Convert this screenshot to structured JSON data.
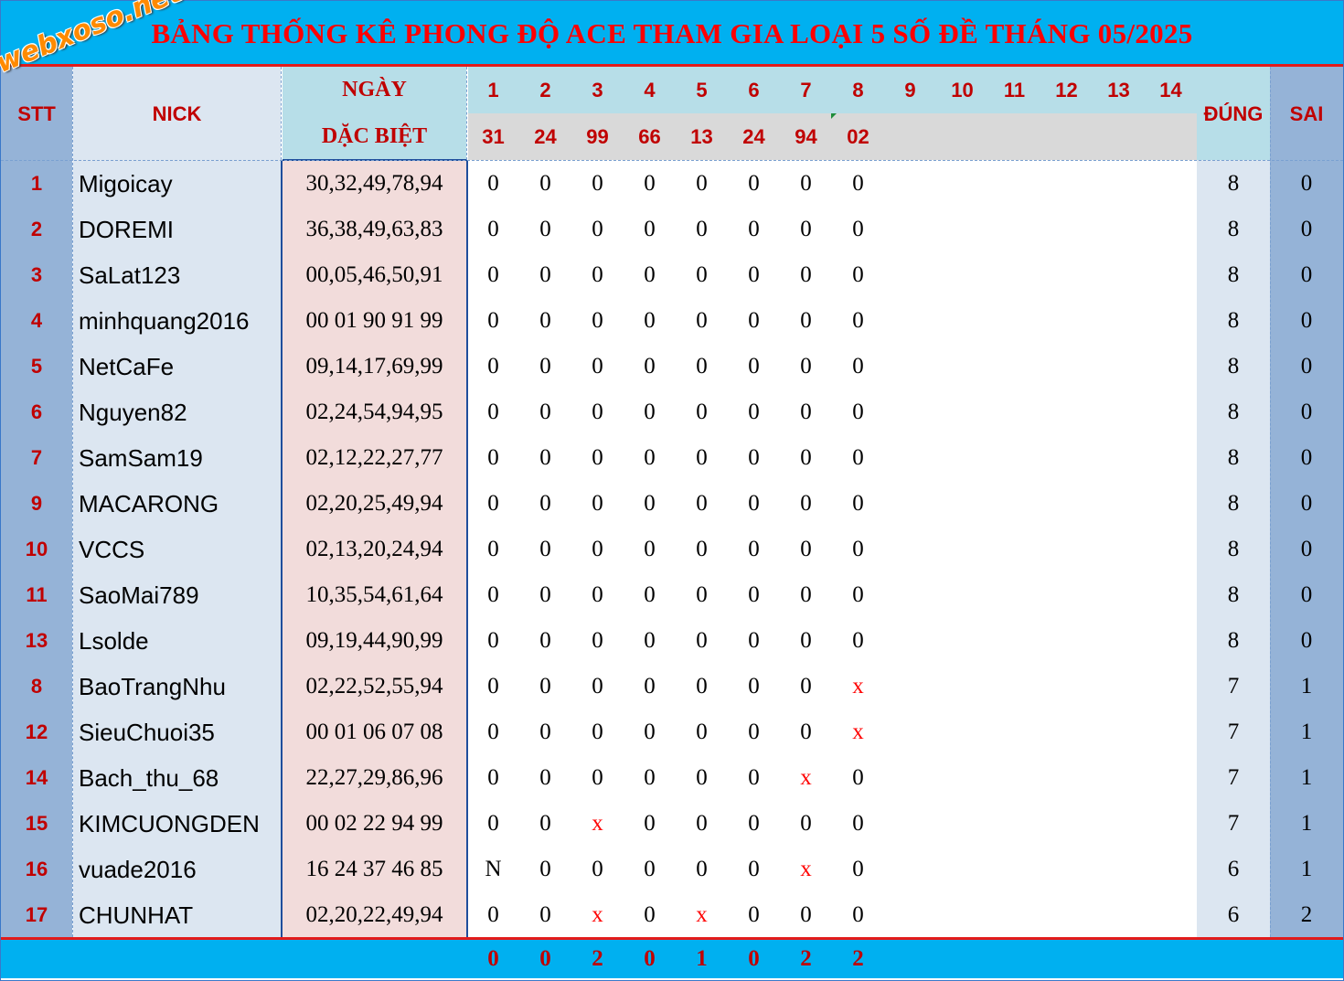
{
  "title": "BẢNG THỐNG KÊ PHONG ĐỘ ACE THAM GIA LOẠI 5 SỐ ĐỀ THÁNG 05/2025",
  "logo": "webxoso.net",
  "headers": {
    "stt": "STT",
    "nick": "NICK",
    "ngay": "NGÀY",
    "dac_biet": "DẶC BIỆT",
    "dung": "ĐÚNG",
    "sai": "SAI"
  },
  "days": [
    "1",
    "2",
    "3",
    "4",
    "5",
    "6",
    "7",
    "8",
    "9",
    "10",
    "11",
    "12",
    "13",
    "14"
  ],
  "specials": [
    "31",
    "24",
    "99",
    "66",
    "13",
    "24",
    "94",
    "02"
  ],
  "rows": [
    {
      "stt": "1",
      "nick": "Migoicay",
      "numbers": "30,32,49,78,94",
      "marks": [
        "0",
        "0",
        "0",
        "0",
        "0",
        "0",
        "0",
        "0"
      ],
      "dung": "8",
      "sai": "0"
    },
    {
      "stt": "2",
      "nick": "DOREMI",
      "numbers": "36,38,49,63,83",
      "marks": [
        "0",
        "0",
        "0",
        "0",
        "0",
        "0",
        "0",
        "0"
      ],
      "dung": "8",
      "sai": "0"
    },
    {
      "stt": "3",
      "nick": "SaLat123",
      "numbers": "00,05,46,50,91",
      "marks": [
        "0",
        "0",
        "0",
        "0",
        "0",
        "0",
        "0",
        "0"
      ],
      "dung": "8",
      "sai": "0"
    },
    {
      "stt": "4",
      "nick": "minhquang2016",
      "numbers": "00 01 90 91 99",
      "marks": [
        "0",
        "0",
        "0",
        "0",
        "0",
        "0",
        "0",
        "0"
      ],
      "dung": "8",
      "sai": "0"
    },
    {
      "stt": "5",
      "nick": "NetCaFe",
      "numbers": "09,14,17,69,99",
      "marks": [
        "0",
        "0",
        "0",
        "0",
        "0",
        "0",
        "0",
        "0"
      ],
      "dung": "8",
      "sai": "0"
    },
    {
      "stt": "6",
      "nick": "Nguyen82",
      "numbers": "02,24,54,94,95",
      "marks": [
        "0",
        "0",
        "0",
        "0",
        "0",
        "0",
        "0",
        "0"
      ],
      "dung": "8",
      "sai": "0"
    },
    {
      "stt": "7",
      "nick": "SamSam19",
      "numbers": "02,12,22,27,77",
      "marks": [
        "0",
        "0",
        "0",
        "0",
        "0",
        "0",
        "0",
        "0"
      ],
      "dung": "8",
      "sai": "0"
    },
    {
      "stt": "9",
      "nick": "MACARONG",
      "numbers": "02,20,25,49,94",
      "marks": [
        "0",
        "0",
        "0",
        "0",
        "0",
        "0",
        "0",
        "0"
      ],
      "dung": "8",
      "sai": "0"
    },
    {
      "stt": "10",
      "nick": "VCCS",
      "numbers": "02,13,20,24,94",
      "marks": [
        "0",
        "0",
        "0",
        "0",
        "0",
        "0",
        "0",
        "0"
      ],
      "dung": "8",
      "sai": "0"
    },
    {
      "stt": "11",
      "nick": "SaoMai789",
      "numbers": "10,35,54,61,64",
      "marks": [
        "0",
        "0",
        "0",
        "0",
        "0",
        "0",
        "0",
        "0"
      ],
      "dung": "8",
      "sai": "0"
    },
    {
      "stt": "13",
      "nick": "Lsolde",
      "numbers": "09,19,44,90,99",
      "marks": [
        "0",
        "0",
        "0",
        "0",
        "0",
        "0",
        "0",
        "0"
      ],
      "dung": "8",
      "sai": "0"
    },
    {
      "stt": "8",
      "nick": "BaoTrangNhu",
      "numbers": "02,22,52,55,94",
      "marks": [
        "0",
        "0",
        "0",
        "0",
        "0",
        "0",
        "0",
        "x"
      ],
      "dung": "7",
      "sai": "1"
    },
    {
      "stt": "12",
      "nick": "SieuChuoi35",
      "numbers": "00 01 06 07 08",
      "marks": [
        "0",
        "0",
        "0",
        "0",
        "0",
        "0",
        "0",
        "x"
      ],
      "dung": "7",
      "sai": "1"
    },
    {
      "stt": "14",
      "nick": "Bach_thu_68",
      "numbers": "22,27,29,86,96",
      "marks": [
        "0",
        "0",
        "0",
        "0",
        "0",
        "0",
        "x",
        "0"
      ],
      "dung": "7",
      "sai": "1"
    },
    {
      "stt": "15",
      "nick": "KIMCUONGDEN",
      "numbers": "00 02 22 94 99",
      "marks": [
        "0",
        "0",
        "x",
        "0",
        "0",
        "0",
        "0",
        "0"
      ],
      "dung": "7",
      "sai": "1"
    },
    {
      "stt": "16",
      "nick": "vuade2016",
      "numbers": "16 24 37 46 85",
      "marks": [
        "N",
        "0",
        "0",
        "0",
        "0",
        "0",
        "x",
        "0"
      ],
      "dung": "6",
      "sai": "1"
    },
    {
      "stt": "17",
      "nick": "CHUNHAT",
      "numbers": "02,20,22,49,94",
      "marks": [
        "0",
        "0",
        "x",
        "0",
        "x",
        "0",
        "0",
        "0"
      ],
      "dung": "6",
      "sai": "2"
    }
  ],
  "totals": [
    "0",
    "0",
    "2",
    "0",
    "1",
    "0",
    "2",
    "2"
  ],
  "colors": {
    "title_bg": "#00b0f0",
    "title_text": "#ff0000",
    "header_text": "#c00000",
    "stt_col": "#95b3d7",
    "nick_col": "#dce6f1",
    "ngay_col": "#f2dcdb",
    "header_light": "#b7dee8",
    "special_row_bg": "#d9d9d9",
    "miss_mark": "#ff0000",
    "logo": "#ff8a00"
  }
}
